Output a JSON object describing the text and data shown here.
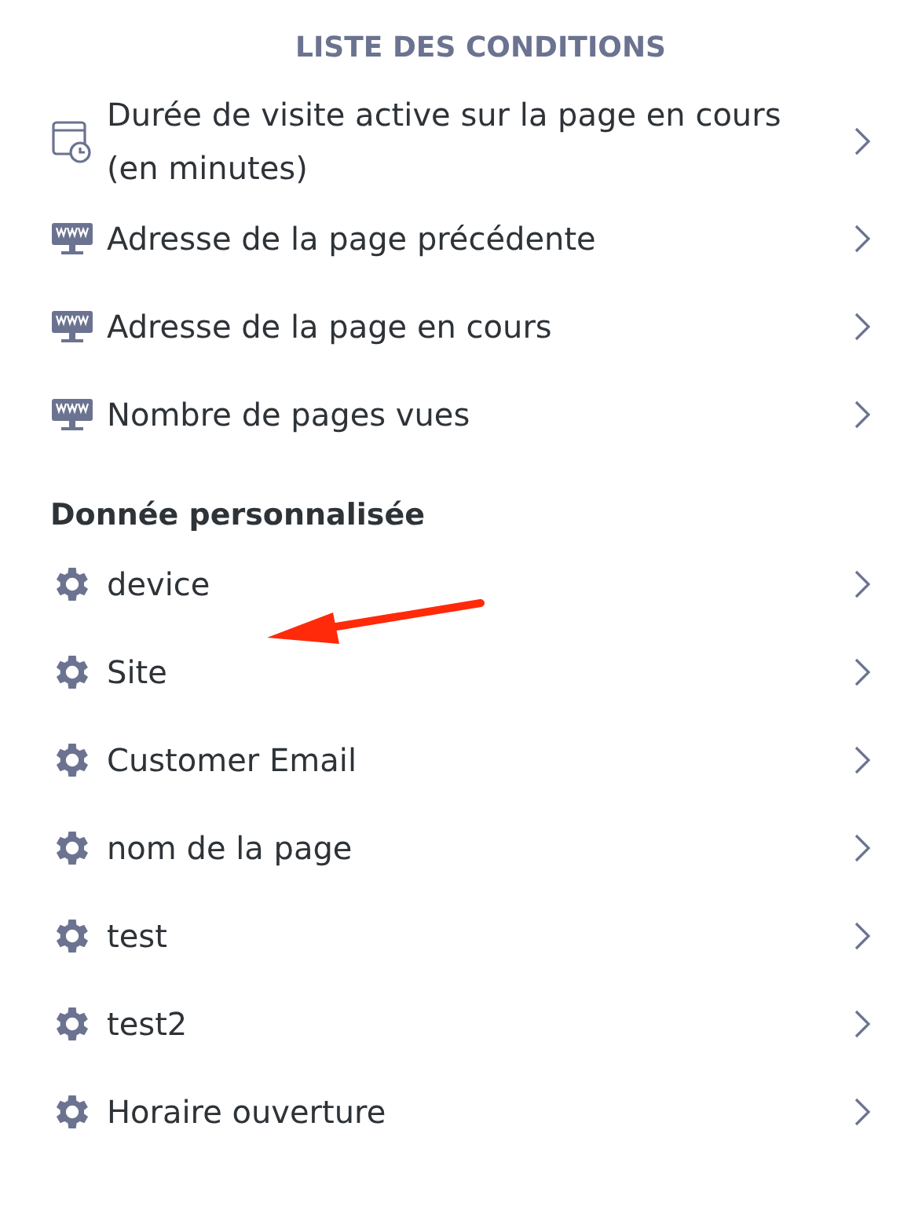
{
  "title": "LISTE DES CONDITIONS",
  "sections": [
    {
      "items": [
        {
          "kind": "schedule",
          "label": "Durée de visite active sur la page en cours (en minutes)"
        },
        {
          "kind": "web",
          "label": "Adresse de la page précédente"
        },
        {
          "kind": "web",
          "label": "Adresse de la page en cours"
        },
        {
          "kind": "web",
          "label": "Nombre de pages vues"
        }
      ]
    },
    {
      "heading": "Donnée personnalisée",
      "items": [
        {
          "kind": "custom",
          "label": "device"
        },
        {
          "kind": "custom",
          "label": "Site"
        },
        {
          "kind": "custom",
          "label": "Customer Email"
        },
        {
          "kind": "custom",
          "label": "nom de la page"
        },
        {
          "kind": "custom",
          "label": "test"
        },
        {
          "kind": "custom",
          "label": "test2"
        },
        {
          "kind": "custom",
          "label": "Horaire ouverture"
        }
      ]
    }
  ]
}
